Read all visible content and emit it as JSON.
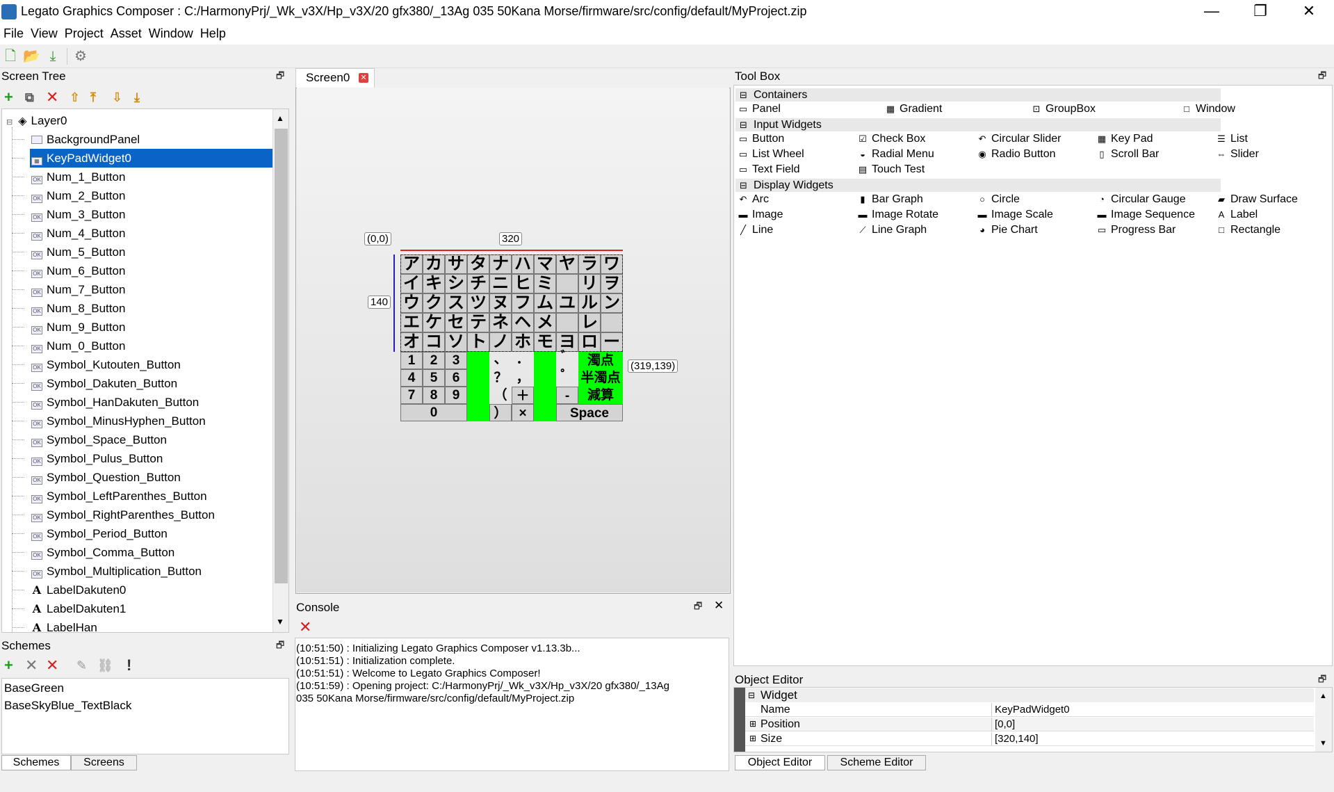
{
  "window": {
    "title": "Legato Graphics Composer : C:/HarmonyPrj/_Wk_v3X/Hp_v3X/20 gfx380/_13Ag 035 50Kana Morse/firmware/src/config/default/MyProject.zip",
    "minimize": "—",
    "restore": "❐",
    "close": "✕"
  },
  "menu": [
    "File",
    "View",
    "Project",
    "Asset",
    "Window",
    "Help"
  ],
  "screen_tree": {
    "title": "Screen Tree",
    "root": "Layer0",
    "items": [
      {
        "label": "BackgroundPanel",
        "icon": "panel"
      },
      {
        "label": "KeyPadWidget0",
        "icon": "keypad",
        "selected": true
      },
      {
        "label": "Num_1_Button",
        "icon": "button"
      },
      {
        "label": "Num_2_Button",
        "icon": "button"
      },
      {
        "label": "Num_3_Button",
        "icon": "button"
      },
      {
        "label": "Num_4_Button",
        "icon": "button"
      },
      {
        "label": "Num_5_Button",
        "icon": "button"
      },
      {
        "label": "Num_6_Button",
        "icon": "button"
      },
      {
        "label": "Num_7_Button",
        "icon": "button"
      },
      {
        "label": "Num_8_Button",
        "icon": "button"
      },
      {
        "label": "Num_9_Button",
        "icon": "button"
      },
      {
        "label": "Num_0_Button",
        "icon": "button"
      },
      {
        "label": "Symbol_Kutouten_Button",
        "icon": "button"
      },
      {
        "label": "Symbol_Dakuten_Button",
        "icon": "button"
      },
      {
        "label": "Symbol_HanDakuten_Button",
        "icon": "button"
      },
      {
        "label": "Symbol_MinusHyphen_Button",
        "icon": "button"
      },
      {
        "label": "Symbol_Space_Button",
        "icon": "button"
      },
      {
        "label": "Symbol_Pulus_Button",
        "icon": "button"
      },
      {
        "label": "Symbol_Question_Button",
        "icon": "button"
      },
      {
        "label": "Symbol_LeftParenthes_Button",
        "icon": "button"
      },
      {
        "label": "Symbol_RightParenthes_Button",
        "icon": "button"
      },
      {
        "label": "Symbol_Period_Button",
        "icon": "button"
      },
      {
        "label": "Symbol_Comma_Button",
        "icon": "button"
      },
      {
        "label": "Symbol_Multiplication_Button",
        "icon": "button"
      },
      {
        "label": "LabelDakuten0",
        "icon": "label"
      },
      {
        "label": "LabelDakuten1",
        "icon": "label"
      },
      {
        "label": "LabelHan",
        "icon": "label"
      }
    ]
  },
  "schemes": {
    "title": "Schemes",
    "items": [
      "BaseGreen",
      "BaseSkyBlue_TextBlack"
    ],
    "tabs": [
      "Schemes",
      "Screens"
    ]
  },
  "editor": {
    "tab": "Screen0",
    "keypad_rows": [
      [
        "ア",
        "カ",
        "サ",
        "タ",
        "ナ",
        "ハ",
        "マ",
        "ヤ",
        "ラ",
        "ワ"
      ],
      [
        "イ",
        "キ",
        "シ",
        "チ",
        "ニ",
        "ヒ",
        "ミ",
        "",
        "リ",
        "ヲ"
      ],
      [
        "ウ",
        "ク",
        "ス",
        "ツ",
        "ヌ",
        "フ",
        "ム",
        "ユ",
        "ル",
        "ン"
      ],
      [
        "エ",
        "ケ",
        "セ",
        "テ",
        "ネ",
        "ヘ",
        "メ",
        "",
        "レ",
        ""
      ],
      [
        "オ",
        "コ",
        "ソ",
        "ト",
        "ノ",
        "ホ",
        "モ",
        "ヨ",
        "ロ",
        "ー"
      ]
    ],
    "num_rows": [
      [
        "1",
        "2",
        "3"
      ],
      [
        "4",
        "5",
        "6"
      ],
      [
        "7",
        "8",
        "9"
      ]
    ],
    "num_zero": "0",
    "symbols": {
      "kutouten": "、",
      "period": "．",
      "question": "？",
      "comma": "，",
      "lparen": "（",
      "plus": "＋",
      "rparen": "）",
      "times": "×",
      "dakuten_mark": "゛",
      "handakuten_mark": "゜",
      "minus": "-",
      "label_dakuten": "濁点",
      "label_handakuten": "半濁点",
      "label_delete": "減算",
      "space": "Space"
    },
    "tags": {
      "origin": "(0,0)",
      "width": "320",
      "height": "140",
      "end": "(319,139)"
    }
  },
  "console": {
    "title": "Console",
    "lines": [
      "(10:51:50) : Initializing Legato Graphics Composer v1.13.3b...",
      "(10:51:51) : Initialization complete.",
      "(10:51:51) : Welcome to Legato Graphics Composer!",
      "(10:51:59) : Opening project: C:/HarmonyPrj/_Wk_v3X/Hp_v3X/20 gfx380/_13Ag",
      "035 50Kana Morse/firmware/src/config/default/MyProject.zip"
    ]
  },
  "toolbox": {
    "title": "Tool Box",
    "sections": [
      {
        "name": "Containers",
        "tools": [
          {
            "label": "Panel",
            "icon": "▭"
          },
          {
            "label": "Gradient",
            "icon": "▦"
          },
          {
            "label": "GroupBox",
            "icon": "⊡"
          },
          {
            "label": "Window",
            "icon": "□"
          }
        ]
      },
      {
        "name": "Input Widgets",
        "tools": [
          {
            "label": "Button",
            "icon": "▭"
          },
          {
            "label": "Check Box",
            "icon": "☑"
          },
          {
            "label": "Circular Slider",
            "icon": "↶"
          },
          {
            "label": "Key Pad",
            "icon": "▦"
          },
          {
            "label": "List",
            "icon": "☰"
          },
          {
            "label": "List Wheel",
            "icon": "▭"
          },
          {
            "label": "Radial Menu",
            "icon": "◒"
          },
          {
            "label": "Radio Button",
            "icon": "◉"
          },
          {
            "label": "Scroll Bar",
            "icon": "▯"
          },
          {
            "label": "Slider",
            "icon": "⇔"
          },
          {
            "label": "Text Field",
            "icon": "▭"
          },
          {
            "label": "Touch Test",
            "icon": "▤"
          }
        ]
      },
      {
        "name": "Display Widgets",
        "tools": [
          {
            "label": "Arc",
            "icon": "↶"
          },
          {
            "label": "Bar Graph",
            "icon": "▮"
          },
          {
            "label": "Circle",
            "icon": "○"
          },
          {
            "label": "Circular Gauge",
            "icon": "◔"
          },
          {
            "label": "Draw Surface",
            "icon": "▰"
          },
          {
            "label": "Image",
            "icon": "▬"
          },
          {
            "label": "Image Rotate",
            "icon": "▬"
          },
          {
            "label": "Image Scale",
            "icon": "▬"
          },
          {
            "label": "Image Sequence",
            "icon": "▬"
          },
          {
            "label": "Label",
            "icon": "A"
          },
          {
            "label": "Line",
            "icon": "╱"
          },
          {
            "label": "Line Graph",
            "icon": "⟋"
          },
          {
            "label": "Pie Chart",
            "icon": "◕"
          },
          {
            "label": "Progress Bar",
            "icon": "▭"
          },
          {
            "label": "Rectangle",
            "icon": "□"
          }
        ]
      }
    ]
  },
  "object_editor": {
    "title": "Object Editor",
    "group": "Widget",
    "rows": [
      {
        "name": "Name",
        "value": "KeyPadWidget0"
      },
      {
        "name": "Position",
        "value": "[0,0]"
      },
      {
        "name": "Size",
        "value": "[320,140]"
      }
    ],
    "tabs": [
      "Object Editor",
      "Scheme Editor"
    ]
  },
  "colors": {
    "selection": "#0a64c8",
    "key_green": "#00ff00",
    "delete_red": "#d42020",
    "add_green": "#1aa31a"
  }
}
